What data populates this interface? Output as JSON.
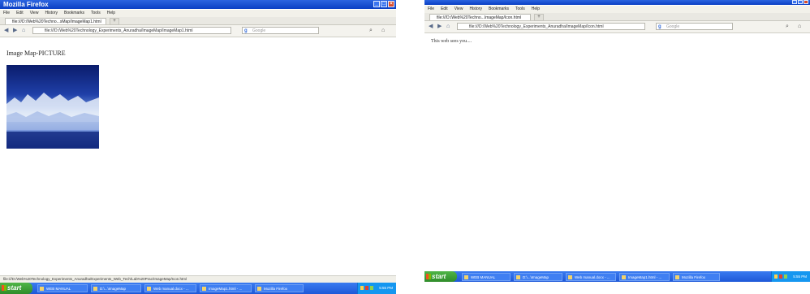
{
  "left_window": {
    "title": "Mozilla Firefox",
    "menu": [
      "File",
      "Edit",
      "View",
      "History",
      "Bookmarks",
      "Tools",
      "Help"
    ],
    "tab_title": "file:///D:/Web%20Techno...sMap/ImageMap1.html",
    "new_tab": "+",
    "url": "file:///D:/Web%20Technology_Experiments_Anuradha/ImageMap/ImageMap1.html",
    "search_placeholder": "Google",
    "page_title": "Image Map-PICTURE",
    "status_text": "file:///D:/Web%20Technology_Experiments_Anuradha/Experiments_Web_Tech/Lab%20Prac/ImageMap/Icon.html"
  },
  "right_window": {
    "menu": [
      "File",
      "Edit",
      "View",
      "History",
      "Bookmarks",
      "Tools",
      "Help"
    ],
    "tab_title": "file:///D:/Web%20Techno...ImageMap/Icon.html",
    "new_tab": "+",
    "url": "file:///D:/Web%20Technology_Experiments_Anuradha/ImageMap/Icon.html",
    "search_placeholder": "Google",
    "page_message": "This web sees you...."
  },
  "taskbar_left": {
    "start_label": "start",
    "items": [
      "WEB MANUAL",
      "D:\\...\\ImageMap",
      "Web manual.docx - ...",
      "ImageMap1.html - ...",
      "Mozilla Firefox"
    ],
    "clock": "5:55 PM"
  },
  "taskbar_right": {
    "start_label": "start",
    "items": [
      "WEB MANUAL",
      "D:\\...\\ImageMap",
      "Web manual.docx - ...",
      "ImageMap1.html - ...",
      "Mozilla Firefox"
    ],
    "clock": "5:55 PM"
  },
  "colors": {
    "titlebar": "#0a3fc4",
    "taskbar": "#1e58d8",
    "start_button": "#2f8c2a"
  }
}
